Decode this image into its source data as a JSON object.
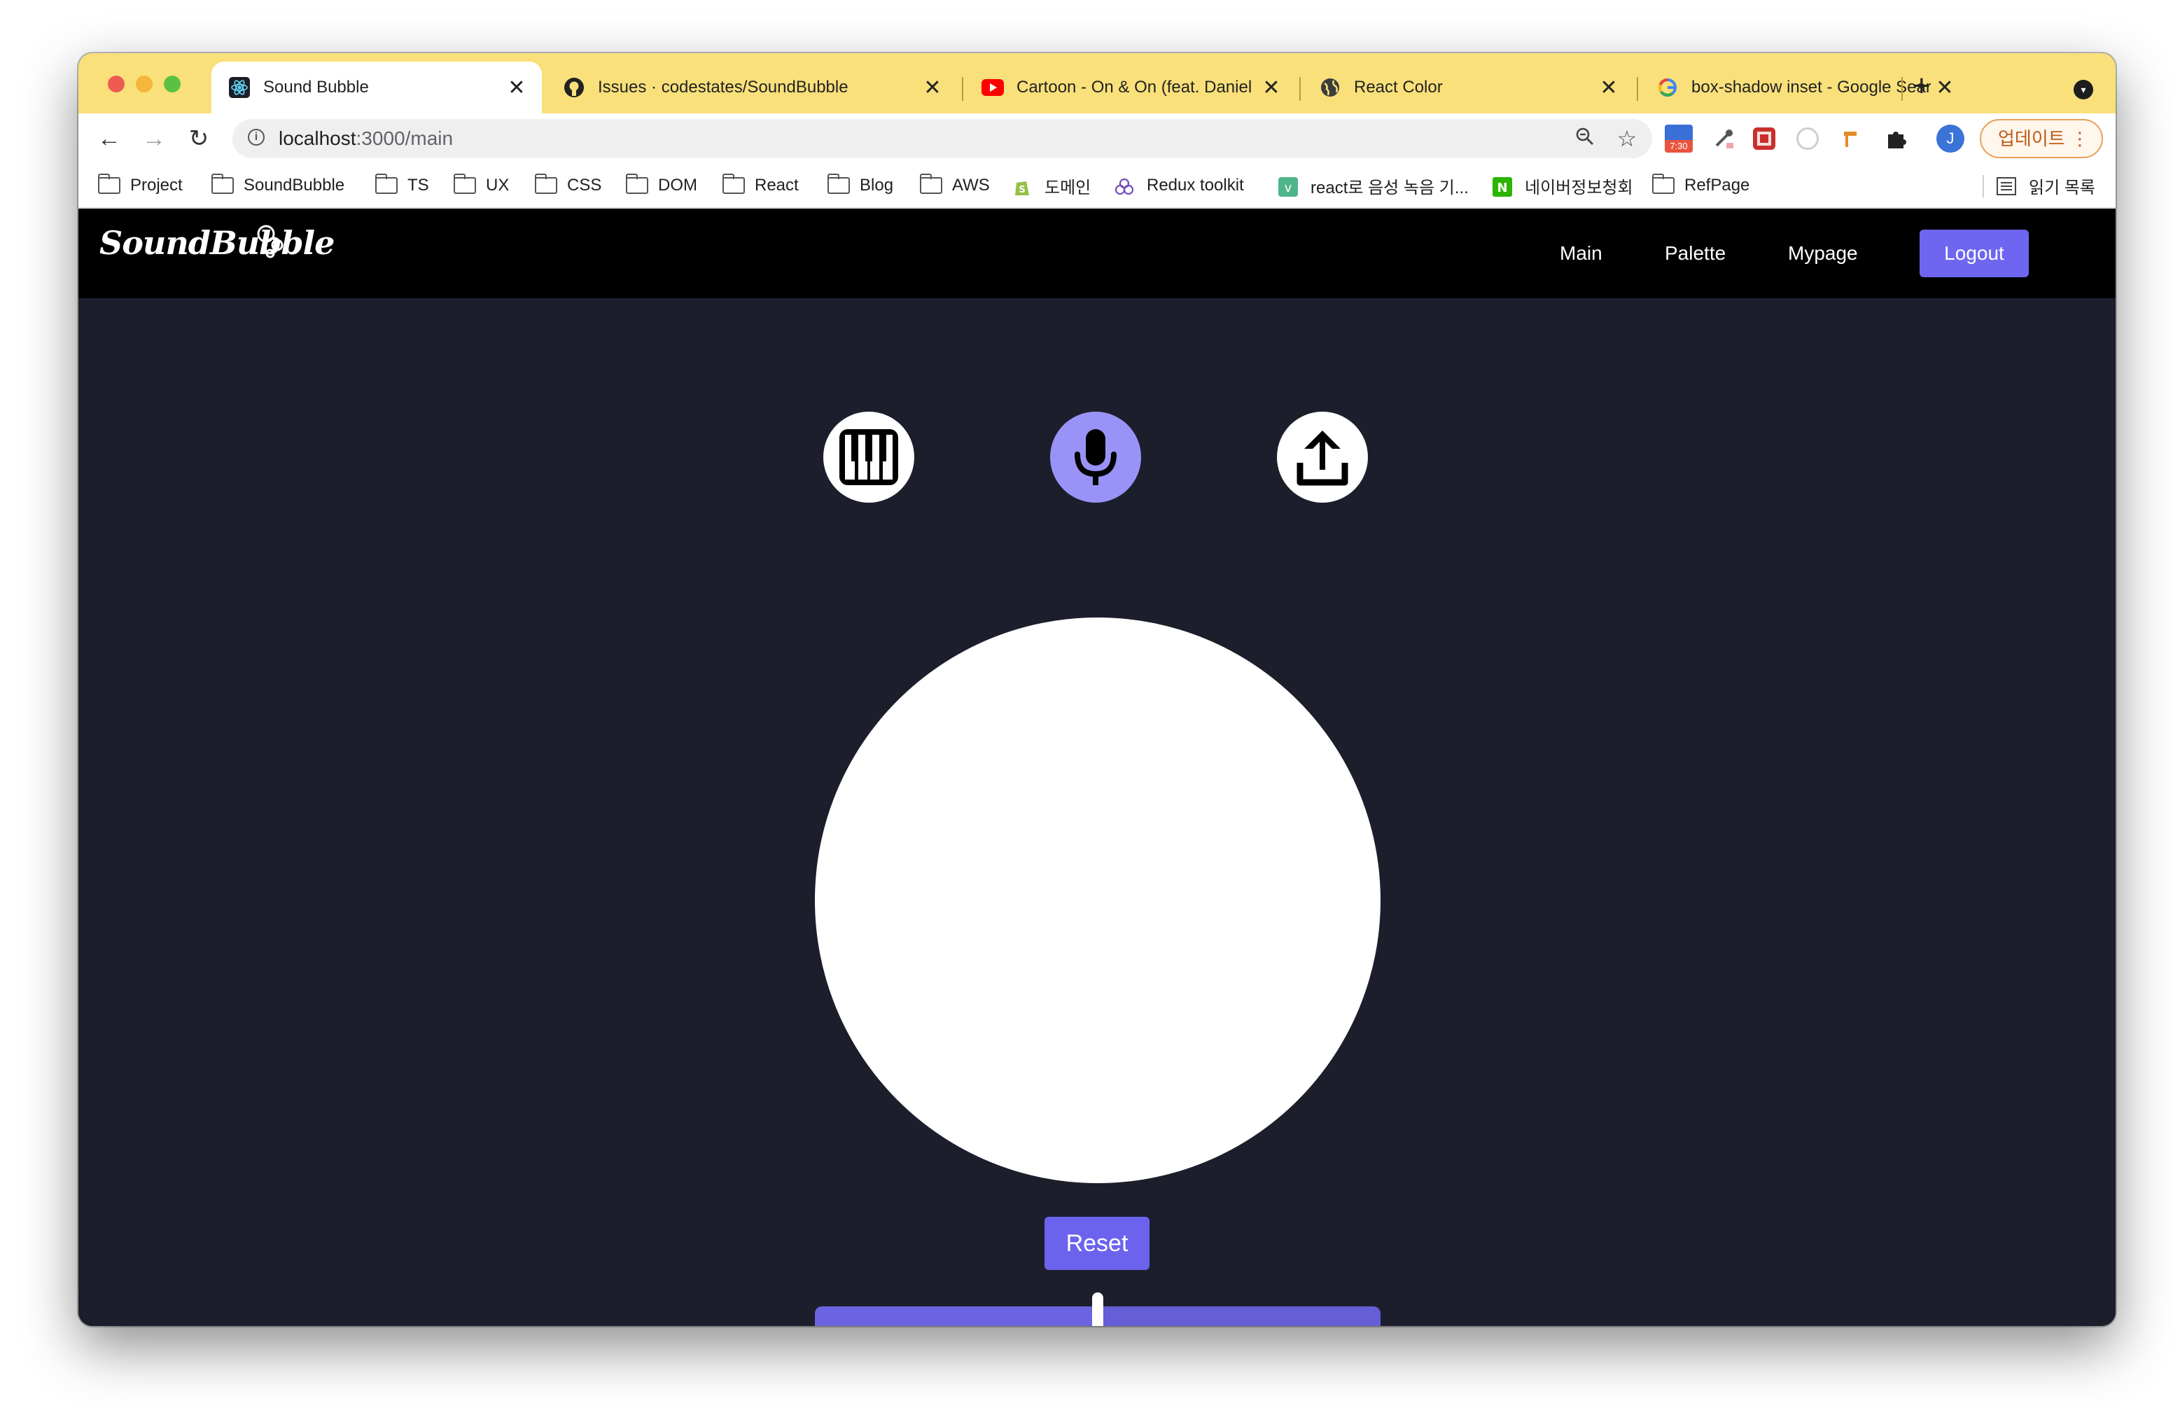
{
  "browser": {
    "tabs": [
      {
        "title": "Sound Bubble",
        "icon": "react-icon",
        "active": true
      },
      {
        "title": "Issues · codestates/SoundBubble",
        "icon": "github-icon",
        "active": false
      },
      {
        "title": "Cartoon - On & On (feat. Daniel Levi)",
        "icon": "youtube-icon",
        "active": false
      },
      {
        "title": "React Color",
        "icon": "globe-icon",
        "active": false
      },
      {
        "title": "box-shadow inset - Google Search",
        "icon": "google-icon",
        "active": false
      }
    ],
    "close_glyph": "✕",
    "new_tab_glyph": "+",
    "url_host": "localhost",
    "url_path": ":3000/main",
    "avatar_letter": "J",
    "update_label": "업데이트",
    "bookmarks": [
      {
        "label": "Project",
        "icon": "folder-icon"
      },
      {
        "label": "SoundBubble",
        "icon": "folder-icon"
      },
      {
        "label": "TS",
        "icon": "folder-icon"
      },
      {
        "label": "UX",
        "icon": "folder-icon"
      },
      {
        "label": "CSS",
        "icon": "folder-icon"
      },
      {
        "label": "DOM",
        "icon": "folder-icon"
      },
      {
        "label": "React",
        "icon": "folder-icon"
      },
      {
        "label": "Blog",
        "icon": "folder-icon"
      },
      {
        "label": "AWS",
        "icon": "folder-icon"
      },
      {
        "label": "도메인",
        "icon": "shopify-icon"
      },
      {
        "label": "Redux toolkit",
        "icon": "redux-icon"
      },
      {
        "label": "react로 음성 녹음 기...",
        "icon": "vue-icon"
      },
      {
        "label": "네이버정보청회",
        "icon": "naver-icon"
      },
      {
        "label": "RefPage",
        "icon": "folder-icon"
      }
    ],
    "reading_list_label": "읽기 목록",
    "extension_badge": "7:30"
  },
  "site": {
    "logo": "SoundBubble",
    "nav": {
      "main": "Main",
      "palette": "Palette",
      "mypage": "Mypage",
      "logout": "Logout"
    },
    "modes": [
      {
        "name": "piano",
        "icon": "piano-icon",
        "active": false
      },
      {
        "name": "microphone",
        "icon": "microphone-icon",
        "active": true
      },
      {
        "name": "upload",
        "icon": "upload-icon",
        "active": false
      }
    ],
    "reset_label": "Reset",
    "slider_value": 0.5
  },
  "colors": {
    "tabstrip": "#f9e07a",
    "page_bg": "#1c1e2b",
    "nav_bg": "#000000",
    "accent": "#6e66f0",
    "mic_active": "#9a93f7"
  }
}
